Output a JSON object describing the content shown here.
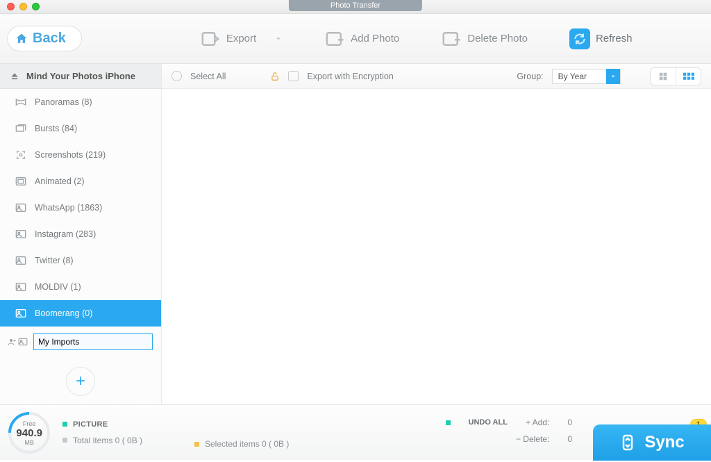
{
  "window": {
    "title": "Photo Transfer"
  },
  "toolbar": {
    "back": "Back",
    "export": "Export",
    "add_photo": "Add Photo",
    "delete_photo": "Delete Photo",
    "refresh": "Refresh"
  },
  "sidebar": {
    "header": "Mind Your Photos iPhone",
    "items": [
      {
        "label": "Panoramas (8)"
      },
      {
        "label": "Bursts (84)"
      },
      {
        "label": "Screenshots (219)"
      },
      {
        "label": "Animated (2)"
      },
      {
        "label": "WhatsApp (1863)"
      },
      {
        "label": "Instagram (283)"
      },
      {
        "label": "Twitter (8)"
      },
      {
        "label": "MOLDIV (1)"
      },
      {
        "label": "Boomerang (0)",
        "selected": true
      }
    ],
    "new_album_value": "My Imports"
  },
  "filter": {
    "select_all": "Select All",
    "export_encryption": "Export with Encryption",
    "group_label": "Group:",
    "group_value": "By Year"
  },
  "footer": {
    "free_label": "Free",
    "free_value": "940.9",
    "free_unit": "MB",
    "picture_label": "PICTURE",
    "total_items": "Total items 0 ( 0B )",
    "selected_items": "Selected items 0 ( 0B )",
    "undo_all": "UNDO ALL",
    "add_label": "+ Add:",
    "add_value": "0",
    "delete_label": "− Delete:",
    "delete_value": "0",
    "sync": "Sync",
    "badge": "1"
  }
}
